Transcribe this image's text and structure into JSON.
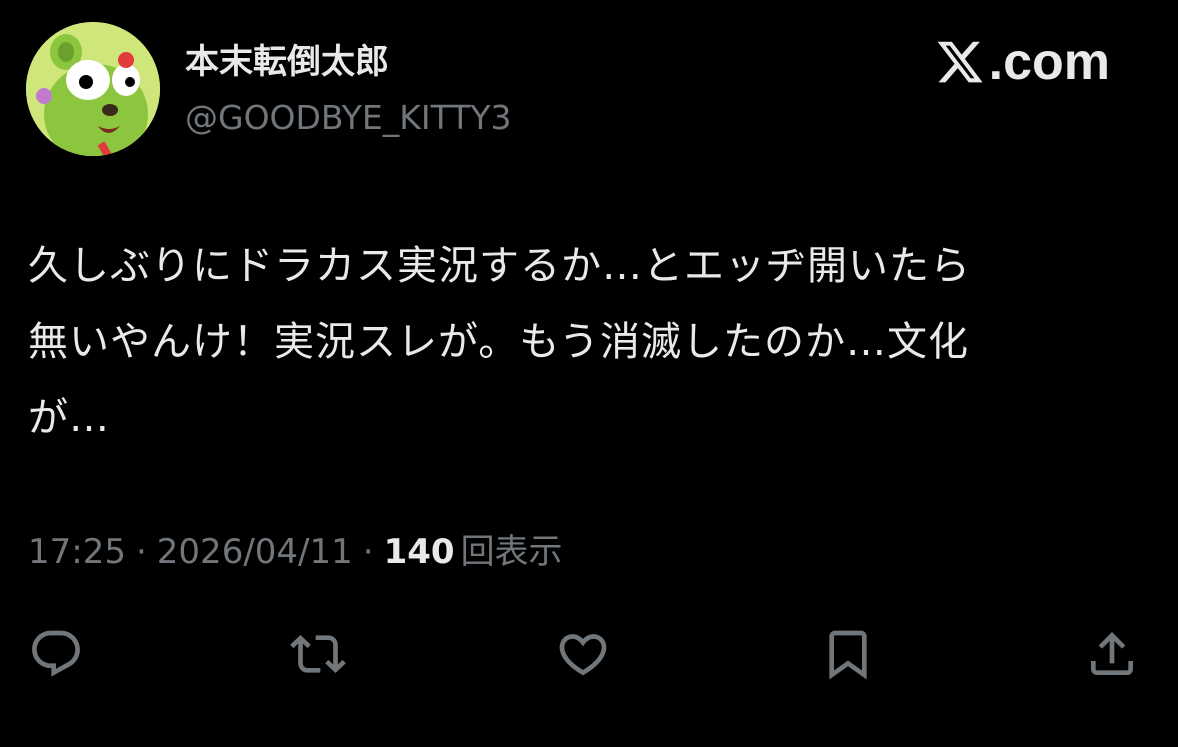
{
  "author": {
    "display_name": "本末転倒太郎",
    "handle": "@GOODBYE_KITTY3"
  },
  "brand": {
    "label": ".com",
    "icon": "x-logo-icon"
  },
  "tweet": {
    "text": "久しぶりにドラカス実況するか…とエッヂ開いたら\n無いやんけ！実況スレが。もう消滅したのか…文化\nが…"
  },
  "meta": {
    "time": "17:25",
    "separator": "·",
    "date": "2026/04/11",
    "views_count": "140",
    "views_label": "回表示"
  },
  "actions": [
    {
      "name": "reply",
      "icon": "reply-icon"
    },
    {
      "name": "retweet",
      "icon": "retweet-icon"
    },
    {
      "name": "like",
      "icon": "heart-icon"
    },
    {
      "name": "bookmark",
      "icon": "bookmark-icon"
    },
    {
      "name": "share",
      "icon": "share-icon"
    }
  ],
  "colors": {
    "background": "#000000",
    "primary_text": "#e7e9ea",
    "secondary_text": "#71767b"
  }
}
